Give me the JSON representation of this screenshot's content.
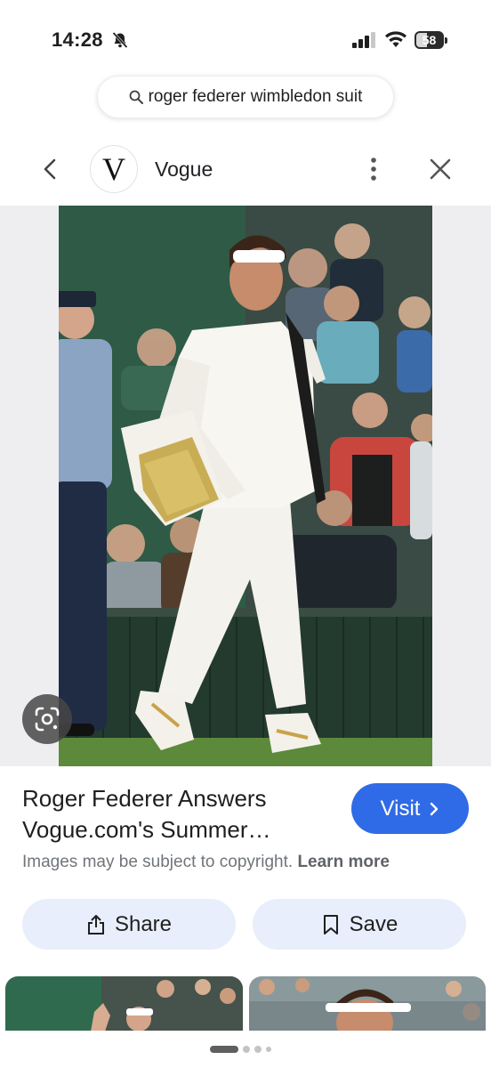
{
  "status_bar": {
    "time": "14:28",
    "battery_percent": "58"
  },
  "search": {
    "query": "roger federer wimbledon suit"
  },
  "header": {
    "source_logo_letter": "V",
    "source_name": "Vogue"
  },
  "result": {
    "title": "Roger Federer Answers Vogue.com's Summer…",
    "visit_label": "Visit",
    "copyright_text": "Images may be subject to copyright.",
    "learn_more_label": "Learn more",
    "share_label": "Share",
    "save_label": "Save"
  },
  "colors": {
    "accent": "#2f6be6",
    "action_button_bg": "#e8eefb",
    "photo_lawn": "#5c8a3a",
    "photo_backdrop": "#2e5a46"
  },
  "icons": [
    "bell-slash-icon",
    "signal-icon",
    "wifi-icon",
    "battery-icon",
    "search-icon",
    "back-arrow-icon",
    "more-vertical-icon",
    "close-icon",
    "google-lens-icon",
    "chevron-right-icon",
    "share-icon",
    "bookmark-icon"
  ],
  "pagination": {
    "page_count": 4,
    "active_page": 1
  }
}
